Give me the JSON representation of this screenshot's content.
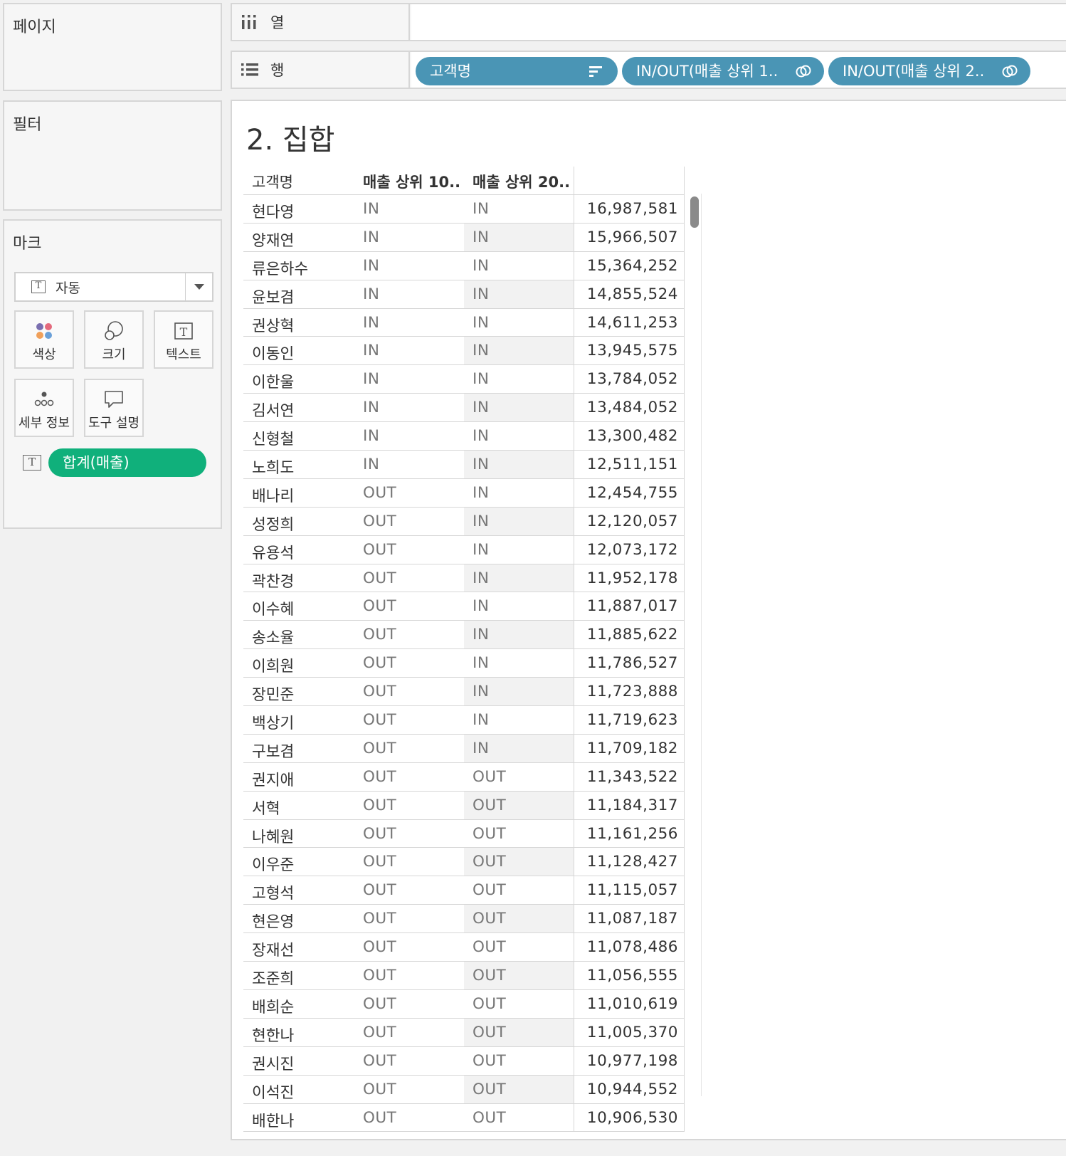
{
  "cards": {
    "pages": "페이지",
    "filters": "필터",
    "marks": "마크"
  },
  "marks": {
    "type": "자동",
    "buttons": {
      "color": "색상",
      "size": "크기",
      "text": "텍스트",
      "detail": "세부 정보",
      "tooltip": "도구 설명"
    },
    "pill": "합계(매출)",
    "pill_color": "#10b07b"
  },
  "shelves": {
    "columns_label": "열",
    "rows_label": "행",
    "row_pills": [
      "고객명",
      "IN/OUT(매출 상위 1..",
      "IN/OUT(매출 상위 2.."
    ],
    "pill_color": "#4a95b5"
  },
  "sheet": {
    "title": "2. 집합",
    "headers": {
      "name": "고객명",
      "a": "매출 상위 10..",
      "b": "매출 상위 20.."
    },
    "rows": [
      {
        "name": "현다영",
        "a": "IN",
        "b": "IN",
        "value": "16,987,581"
      },
      {
        "name": "양재연",
        "a": "IN",
        "b": "IN",
        "value": "15,966,507"
      },
      {
        "name": "류은하수",
        "a": "IN",
        "b": "IN",
        "value": "15,364,252"
      },
      {
        "name": "윤보겸",
        "a": "IN",
        "b": "IN",
        "value": "14,855,524"
      },
      {
        "name": "권상혁",
        "a": "IN",
        "b": "IN",
        "value": "14,611,253"
      },
      {
        "name": "이동인",
        "a": "IN",
        "b": "IN",
        "value": "13,945,575"
      },
      {
        "name": "이한울",
        "a": "IN",
        "b": "IN",
        "value": "13,784,052"
      },
      {
        "name": "김서연",
        "a": "IN",
        "b": "IN",
        "value": "13,484,052"
      },
      {
        "name": "신형철",
        "a": "IN",
        "b": "IN",
        "value": "13,300,482"
      },
      {
        "name": "노희도",
        "a": "IN",
        "b": "IN",
        "value": "12,511,151"
      },
      {
        "name": "배나리",
        "a": "OUT",
        "b": "IN",
        "value": "12,454,755"
      },
      {
        "name": "성정희",
        "a": "OUT",
        "b": "IN",
        "value": "12,120,057"
      },
      {
        "name": "유용석",
        "a": "OUT",
        "b": "IN",
        "value": "12,073,172"
      },
      {
        "name": "곽찬경",
        "a": "OUT",
        "b": "IN",
        "value": "11,952,178"
      },
      {
        "name": "이수혜",
        "a": "OUT",
        "b": "IN",
        "value": "11,887,017"
      },
      {
        "name": "송소율",
        "a": "OUT",
        "b": "IN",
        "value": "11,885,622"
      },
      {
        "name": "이희원",
        "a": "OUT",
        "b": "IN",
        "value": "11,786,527"
      },
      {
        "name": "장민준",
        "a": "OUT",
        "b": "IN",
        "value": "11,723,888"
      },
      {
        "name": "백상기",
        "a": "OUT",
        "b": "IN",
        "value": "11,719,623"
      },
      {
        "name": "구보겸",
        "a": "OUT",
        "b": "IN",
        "value": "11,709,182"
      },
      {
        "name": "권지애",
        "a": "OUT",
        "b": "OUT",
        "value": "11,343,522"
      },
      {
        "name": "서혁",
        "a": "OUT",
        "b": "OUT",
        "value": "11,184,317"
      },
      {
        "name": "나혜원",
        "a": "OUT",
        "b": "OUT",
        "value": "11,161,256"
      },
      {
        "name": "이우준",
        "a": "OUT",
        "b": "OUT",
        "value": "11,128,427"
      },
      {
        "name": "고형석",
        "a": "OUT",
        "b": "OUT",
        "value": "11,115,057"
      },
      {
        "name": "현은영",
        "a": "OUT",
        "b": "OUT",
        "value": "11,087,187"
      },
      {
        "name": "장재선",
        "a": "OUT",
        "b": "OUT",
        "value": "11,078,486"
      },
      {
        "name": "조준희",
        "a": "OUT",
        "b": "OUT",
        "value": "11,056,555"
      },
      {
        "name": "배희순",
        "a": "OUT",
        "b": "OUT",
        "value": "11,010,619"
      },
      {
        "name": "현한나",
        "a": "OUT",
        "b": "OUT",
        "value": "11,005,370"
      },
      {
        "name": "권시진",
        "a": "OUT",
        "b": "OUT",
        "value": "10,977,198"
      },
      {
        "name": "이석진",
        "a": "OUT",
        "b": "OUT",
        "value": "10,944,552"
      },
      {
        "name": "배한나",
        "a": "OUT",
        "b": "OUT",
        "value": "10,906,530"
      }
    ]
  }
}
